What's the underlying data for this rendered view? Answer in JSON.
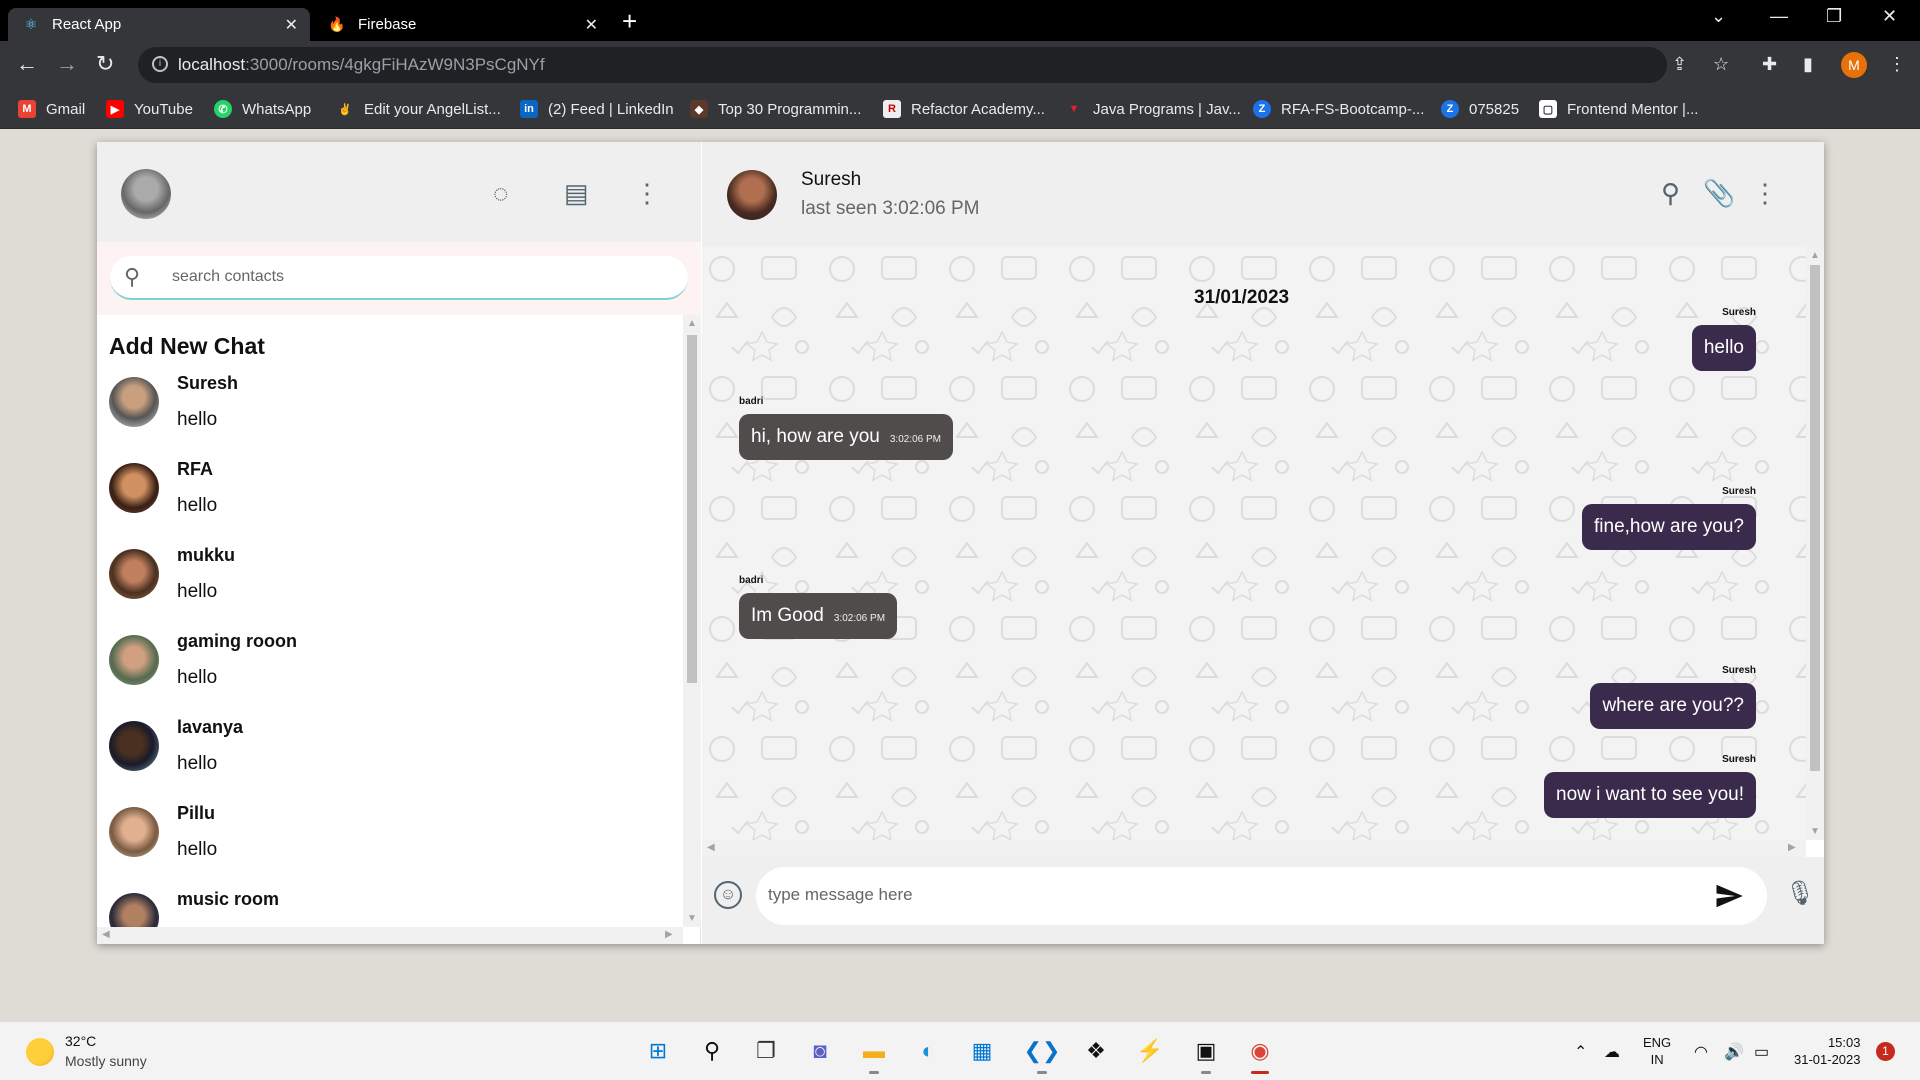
{
  "browser": {
    "tabs": [
      {
        "title": "React App",
        "active": true
      },
      {
        "title": "Firebase",
        "active": false
      }
    ],
    "url_host": "localhost",
    "url_path": ":3000/rooms/4gkgFiHAzW9N3PsCgNYf",
    "profile_initial": "M",
    "bookmarks": [
      {
        "label": "Gmail",
        "icon": "gmail-icon",
        "color": "#ea4335",
        "glyph": "M"
      },
      {
        "label": "YouTube",
        "icon": "youtube-icon",
        "color": "#ff0000",
        "glyph": "▶"
      },
      {
        "label": "WhatsApp",
        "icon": "whatsapp-icon",
        "color": "#25d366",
        "glyph": "✆"
      },
      {
        "label": "Edit your AngelList...",
        "icon": "angellist-icon",
        "color": "#35363a",
        "glyph": "✌"
      },
      {
        "label": "(2) Feed | LinkedIn",
        "icon": "linkedin-icon",
        "color": "#0a66c2",
        "glyph": "in"
      },
      {
        "label": "Top 30 Programmin...",
        "icon": "programming-icon",
        "color": "#5a3a2a",
        "glyph": "◆"
      },
      {
        "label": "Refactor Academy...",
        "icon": "refactor-icon",
        "color": "#eeeeee",
        "glyph": "R"
      },
      {
        "label": "Java Programs | Jav...",
        "icon": "java-icon",
        "color": "#e0202a",
        "glyph": "▼"
      },
      {
        "label": "RFA-FS-Bootcamp-...",
        "icon": "zoho-icon",
        "color": "#1a73e8",
        "glyph": "Z"
      },
      {
        "label": "075825",
        "icon": "zoho-icon",
        "color": "#1a73e8",
        "glyph": "Z"
      },
      {
        "label": "Frontend Mentor |...",
        "icon": "frontend-mentor-icon",
        "color": "#ffffff",
        "glyph": "▢"
      }
    ]
  },
  "sidebar": {
    "search_placeholder": "search contacts",
    "add_new_chat": "Add New Chat",
    "contacts": [
      {
        "name": "Suresh",
        "last_message": "hello"
      },
      {
        "name": "RFA",
        "last_message": "hello"
      },
      {
        "name": "mukku",
        "last_message": "hello"
      },
      {
        "name": "gaming rooon",
        "last_message": "hello"
      },
      {
        "name": "lavanya",
        "last_message": "hello"
      },
      {
        "name": "Pillu",
        "last_message": "hello"
      },
      {
        "name": "music room",
        "last_message": ""
      }
    ]
  },
  "chat": {
    "peer_name": "Suresh",
    "last_seen": "last seen 3:02:06 PM",
    "date": "31/01/2023",
    "messages": [
      {
        "sender": "Suresh",
        "text": "hello",
        "time": "",
        "direction": "out"
      },
      {
        "sender": "badri",
        "text": "hi, how are you",
        "time": "3:02:06 PM",
        "direction": "in"
      },
      {
        "sender": "Suresh",
        "text": "fine,how are you?",
        "time": "",
        "direction": "out"
      },
      {
        "sender": "badri",
        "text": "Im Good",
        "time": "3:02:06 PM",
        "direction": "in"
      },
      {
        "sender": "Suresh",
        "text": "where are you??",
        "time": "",
        "direction": "out"
      },
      {
        "sender": "Suresh",
        "text": "now i want to see you!",
        "time": "",
        "direction": "out"
      }
    ],
    "input_placeholder": "type message here"
  },
  "taskbar": {
    "weather_temp": "32°C",
    "weather_desc": "Mostly sunny",
    "lang_line1": "ENG",
    "lang_line2": "IN",
    "time": "15:03",
    "date": "31-01-2023",
    "notification_count": "1"
  },
  "colors": {
    "incoming_bubble": "#514c4c",
    "outgoing_bubble": "#3a2b4c",
    "header_bg": "#f0efef",
    "search_bg": "#fdf3f3"
  }
}
